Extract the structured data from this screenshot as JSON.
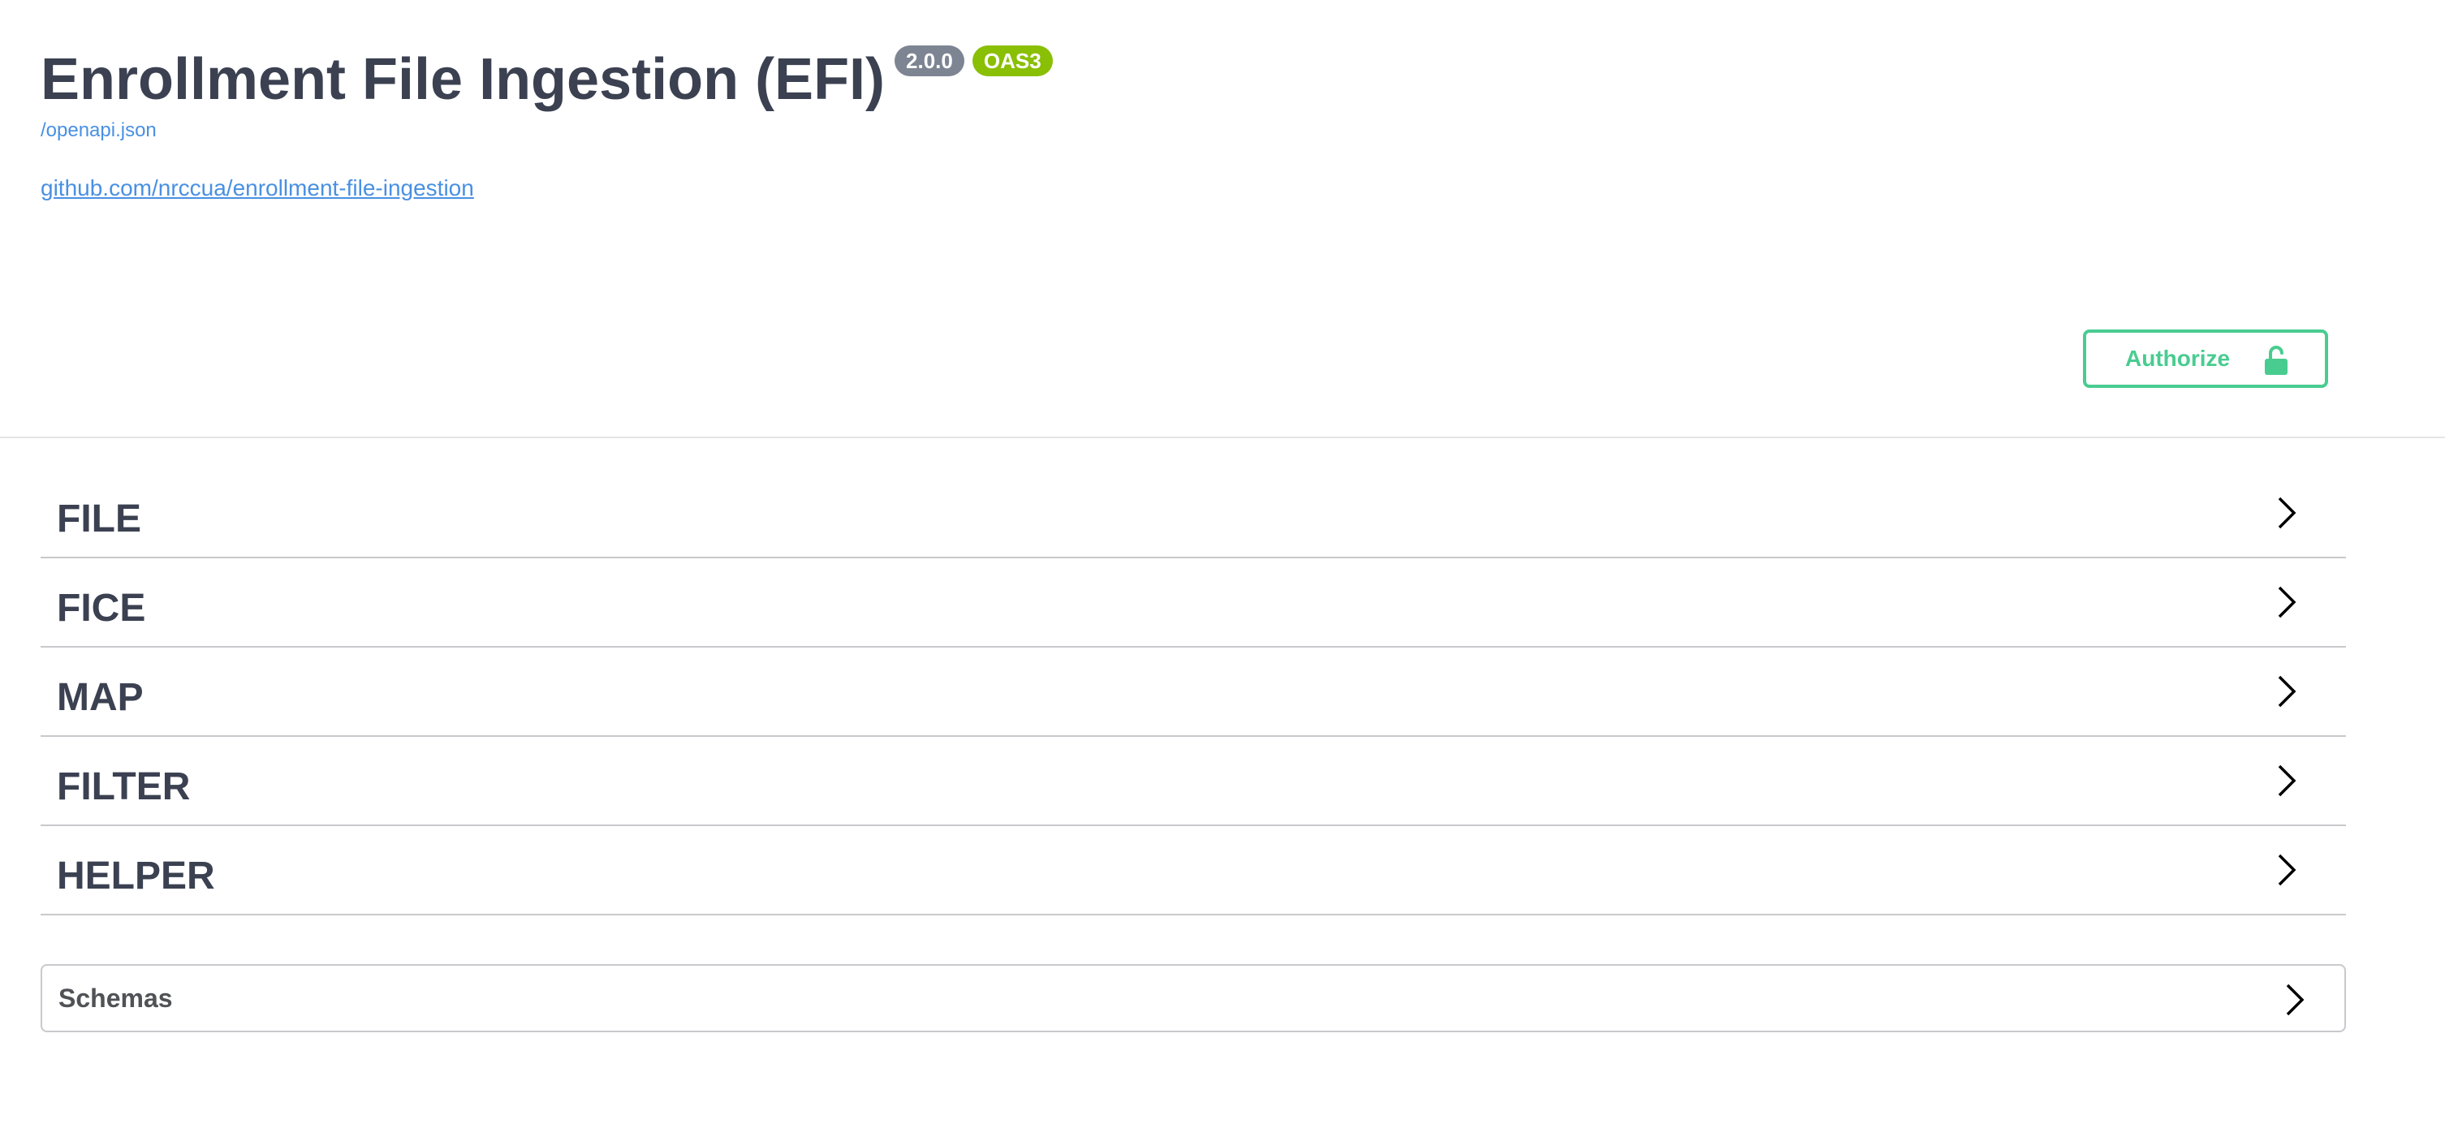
{
  "info": {
    "title": "Enrollment File Ingestion (EFI)",
    "version_badge": "2.0.0",
    "oas_badge": "OAS3",
    "spec_url": "/openapi.json",
    "repo_link": "github.com/nrccua/enrollment-file-ingestion"
  },
  "authorize": {
    "label": "Authorize",
    "icon": "unlocked-padlock-icon"
  },
  "tags": [
    {
      "name": "FILE"
    },
    {
      "name": "FICE"
    },
    {
      "name": "MAP"
    },
    {
      "name": "FILTER"
    },
    {
      "name": "HELPER"
    }
  ],
  "schemas": {
    "label": "Schemas"
  },
  "colors": {
    "accent_green": "#49cc90",
    "link_blue": "#4990e2",
    "version_badge": "#7d8492",
    "oas_badge": "#89bf04",
    "text": "#3b4151"
  }
}
